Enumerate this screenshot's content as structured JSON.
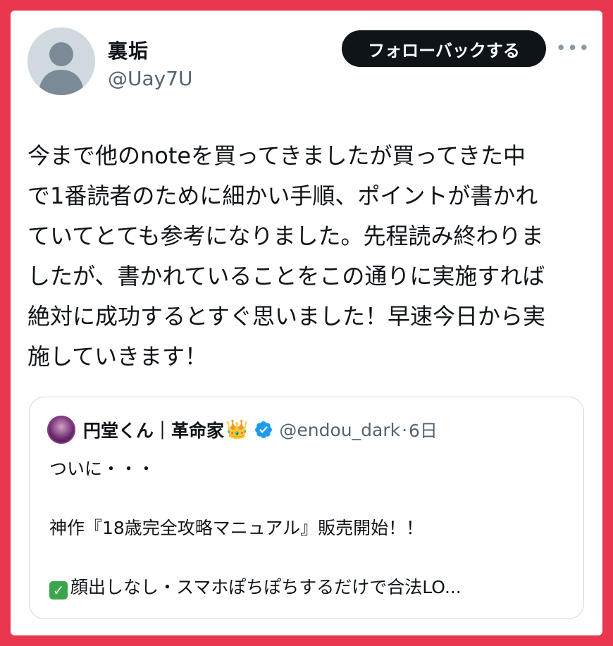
{
  "user": {
    "display_name": "裏垢",
    "handle": "@Uay7U",
    "avatar_icon": "default-profile-icon"
  },
  "follow_button_label": "フォローバックする",
  "more_icon": "more-options-icon",
  "post": {
    "lines": [
      "今まで他のnoteを買ってきましたが買ってきた中",
      "で1番読者のために細かい手順、ポイントが書かれ",
      "ていてとても参考になりました。先程読み終わりま",
      "したが、書かれていることをこの通りに実施すれば",
      "絶対に成功するとすぐ思いました！早速今日から実",
      "施していきます！"
    ]
  },
  "quoted": {
    "display_name": "円堂くん｜革命家",
    "crown": "👑",
    "verified_icon": "verified-badge-icon",
    "handle": "@endou_dark",
    "separator": "·",
    "time": "6日",
    "line1": "ついに・・・",
    "line2": "神作『18歳完全攻略マニュアル』販売開始！！",
    "check": "✓",
    "line3": "顔出しなし・スマホぽちぽちするだけで合法LO..."
  },
  "colors": {
    "frame_border": "#e8364f",
    "text_primary": "#0f1419",
    "text_secondary": "#536471",
    "verified_blue": "#1d9bf0"
  }
}
